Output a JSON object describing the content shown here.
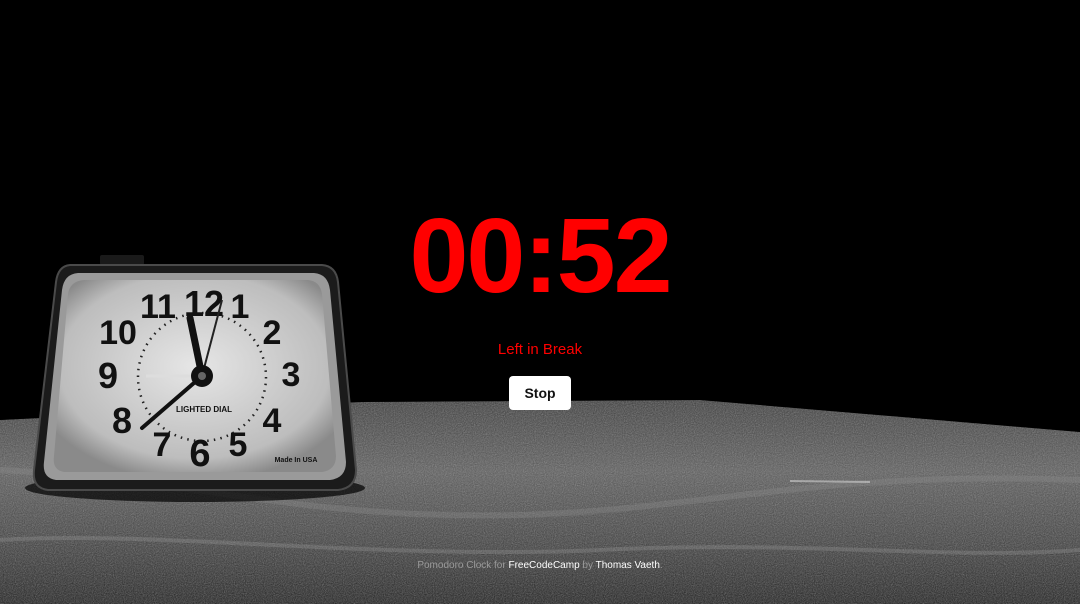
{
  "timer": {
    "display": "00:52",
    "state_label": "Left in Break",
    "color": "#ff0000"
  },
  "controls": {
    "stop_label": "Stop"
  },
  "footer": {
    "prefix": "Pomodoro Clock for",
    "link1": "FreeCodeCamp",
    "middle": "by",
    "link2": "Thomas Vaeth",
    "suffix": "."
  },
  "clock_image": {
    "dial_numbers": [
      "12",
      "1",
      "2",
      "3",
      "4",
      "5",
      "6",
      "7",
      "8",
      "9",
      "10",
      "11"
    ],
    "dial_text": "LIGHTED DIAL",
    "maker_text": "Made In USA"
  }
}
